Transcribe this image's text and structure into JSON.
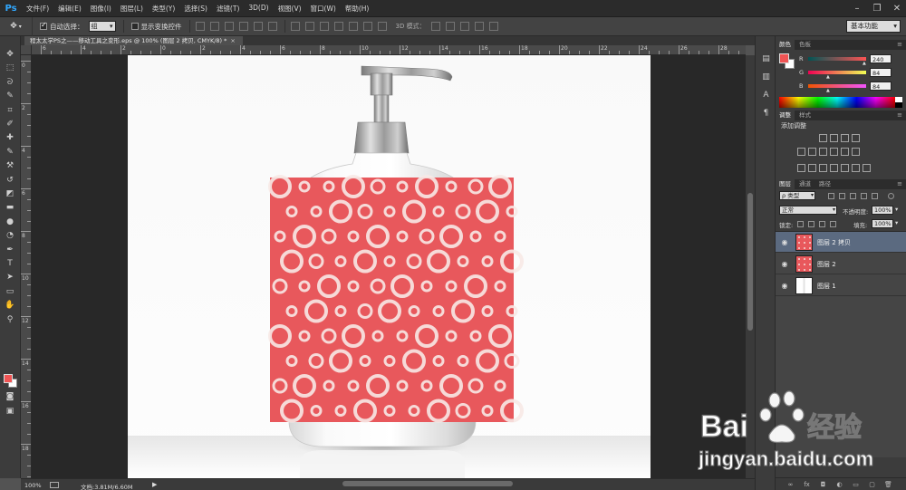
{
  "app": {
    "logo": "Ps"
  },
  "menu": [
    "文件(F)",
    "编辑(E)",
    "图像(I)",
    "图层(L)",
    "类型(Y)",
    "选择(S)",
    "滤镜(T)",
    "3D(D)",
    "视图(V)",
    "窗口(W)",
    "帮助(H)"
  ],
  "window_controls": [
    "minimize-icon",
    "restore-icon",
    "close-icon"
  ],
  "options": {
    "tool_icon": "move-tool-icon",
    "auto_select_label": "自动选择：",
    "auto_select_checked": true,
    "auto_select_value": "组",
    "show_transform_label": "显示变换控件",
    "show_transform_checked": false,
    "mode_3d_label": "3D 模式：",
    "workspace": "基本功能"
  },
  "document": {
    "tab_title": "程太太学PS之——移动工具之变形.eps @ 100% (图层 2 拷贝, CMYK/8) *",
    "zoom": "100%",
    "doc_info": "文档:3.81M/6.60M"
  },
  "rulers": {
    "top": [
      "6",
      "4",
      "2",
      "0",
      "2",
      "4",
      "6",
      "8",
      "10",
      "12",
      "14",
      "16",
      "18",
      "20",
      "22",
      "24",
      "26",
      "28"
    ],
    "left": [
      "0",
      "2",
      "4",
      "6",
      "8",
      "10",
      "12",
      "14",
      "16",
      "18"
    ]
  },
  "tools": [
    "move-tool-icon",
    "marquee-icon",
    "lasso-icon",
    "quick-select-icon",
    "crop-icon",
    "eyedropper-icon",
    "healing-brush-icon",
    "brush-icon",
    "stamp-icon",
    "history-brush-icon",
    "eraser-icon",
    "gradient-icon",
    "blur-icon",
    "dodge-icon",
    "pen-icon",
    "type-icon",
    "path-select-icon",
    "shape-icon",
    "hand-icon",
    "zoom-icon"
  ],
  "tool_glyphs": [
    "✥",
    "⬚",
    "ᘐ",
    "✎",
    "⌗",
    "✐",
    "✚",
    "✎",
    "⚒",
    "↺",
    "◩",
    "▬",
    "●",
    "◔",
    "✒",
    "T",
    "➤",
    "▭",
    "✋",
    "⚲"
  ],
  "color_panel": {
    "tabs": [
      "颜色",
      "色板"
    ],
    "foreground": "#f05454",
    "background": "#ffffff",
    "channels": [
      {
        "label": "R",
        "value": "240"
      },
      {
        "label": "G",
        "value": "84"
      },
      {
        "label": "B",
        "value": "84"
      }
    ]
  },
  "adjust_panel": {
    "tabs": [
      "调整",
      "样式"
    ],
    "title": "添加调整"
  },
  "layers_panel": {
    "tabs": [
      "图层",
      "通道",
      "路径"
    ],
    "kind_filter": "ρ 类型",
    "blend_mode": "正常",
    "opacity_label": "不透明度:",
    "opacity_value": "100%",
    "lock_label": "锁定:",
    "fill_label": "填充:",
    "fill_value": "100%",
    "layers": [
      {
        "name": "图层 2 拷贝",
        "selected": true,
        "thumb": "pattern"
      },
      {
        "name": "图层 2",
        "selected": false,
        "thumb": "pattern"
      },
      {
        "name": "图层 1",
        "selected": false,
        "thumb": "bottle"
      }
    ],
    "footer_icons": [
      "link-icon",
      "fx-icon",
      "mask-icon",
      "adjustment-icon",
      "folder-icon",
      "new-layer-icon",
      "trash-icon"
    ],
    "footer_glyphs": [
      "∞",
      "fx",
      "◘",
      "◐",
      "▭",
      "▢",
      "🗑"
    ]
  },
  "canvas": {
    "pattern_color": "#e8585c",
    "ring_color": "#f7e9e6"
  },
  "watermark": {
    "brand_left": "Bai",
    "brand_right": "经验",
    "url": "jingyan.baidu.com"
  }
}
